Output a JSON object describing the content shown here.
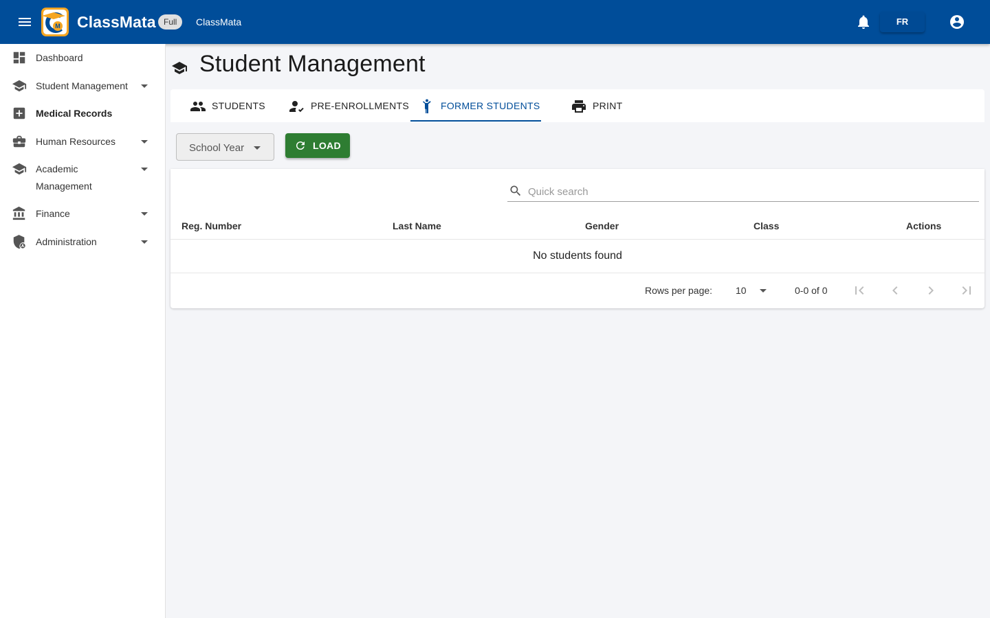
{
  "app": {
    "brand": "ClassMata",
    "plan_badge": "Full",
    "school_name": "ClassMata",
    "language": "FR"
  },
  "sidebar": {
    "items": [
      {
        "label": "Dashboard",
        "icon": "dashboard-icon",
        "expandable": false
      },
      {
        "label": "Student Management",
        "icon": "school-icon",
        "expandable": true
      },
      {
        "label": "Medical Records",
        "icon": "medical-cross-icon",
        "expandable": false
      },
      {
        "label": "Human Resources",
        "icon": "briefcase-icon",
        "expandable": true
      },
      {
        "label": "Academic",
        "label_line2": "Management",
        "icon": "school-icon",
        "expandable": true
      },
      {
        "label": "Finance",
        "icon": "bank-icon",
        "expandable": true
      },
      {
        "label": "Administration",
        "icon": "admin-shield-icon",
        "expandable": true
      }
    ]
  },
  "page": {
    "title": "Student Management",
    "icon": "school-icon"
  },
  "tabs": [
    {
      "label": "STUDENTS",
      "icon": "people-icon",
      "active": false
    },
    {
      "label": "PRE-ENROLLMENTS",
      "icon": "person-check-icon",
      "active": false
    },
    {
      "label": "FORMER STUDENTS",
      "icon": "person-leaving-icon",
      "active": true
    },
    {
      "label": "PRINT",
      "icon": "printer-icon",
      "active": false
    }
  ],
  "filters": {
    "school_year_label": "School Year",
    "load_label": "LOAD"
  },
  "table": {
    "search_placeholder": "Quick search",
    "columns": [
      "Reg. Number",
      "Last Name",
      "Gender",
      "Class",
      "Actions"
    ],
    "rows": [],
    "empty_message": "No students found"
  },
  "pagination": {
    "rows_per_page_label": "Rows per page:",
    "rows_per_page": "10",
    "range": "0-0 of 0"
  },
  "colors": {
    "appbar": "#004d99",
    "accent": "#004d99",
    "load_button": "#2e7d32",
    "background": "#f4f5f8"
  }
}
